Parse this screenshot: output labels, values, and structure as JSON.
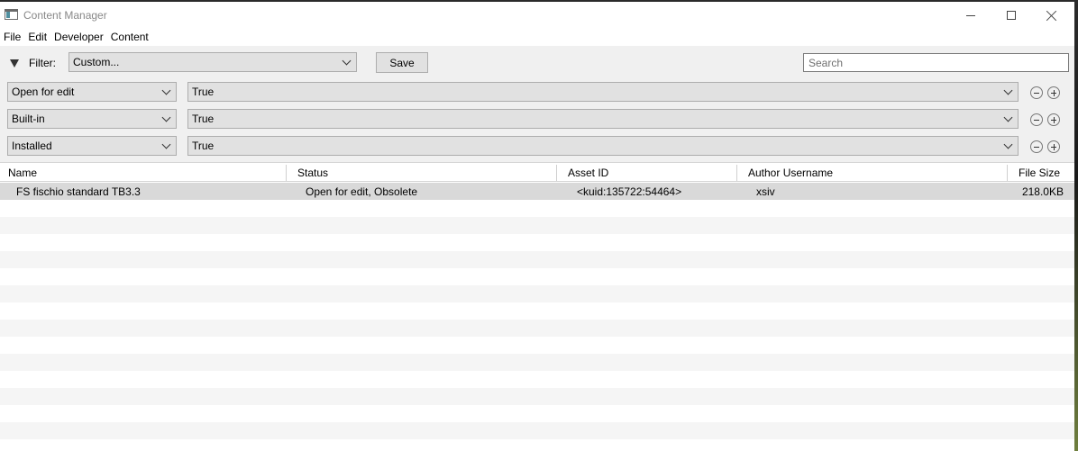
{
  "window": {
    "title": "Content Manager",
    "controls": {
      "minimize": "minimize",
      "maximize": "maximize",
      "close": "close"
    }
  },
  "menu": [
    "File",
    "Edit",
    "Developer",
    "Content"
  ],
  "filter": {
    "label": "Filter:",
    "selected": "Custom...",
    "save_label": "Save",
    "search_placeholder": "Search",
    "rules": [
      {
        "key": "Open for edit",
        "value": "True"
      },
      {
        "key": "Built-in",
        "value": "True"
      },
      {
        "key": "Installed",
        "value": "True"
      }
    ]
  },
  "table": {
    "columns": [
      "Name",
      "Status",
      "Asset ID",
      "Author Username",
      "File Size"
    ],
    "rows": [
      {
        "name": "FS fischio standard TB3.3",
        "status": "Open for edit, Obsolete",
        "asset_id": "<kuid:135722:54464>",
        "author": "xsiv",
        "size": "218.0KB"
      }
    ]
  },
  "colors": {
    "filter_bg": "#f0f0f0",
    "selected_row": "#d9d9d9",
    "alt_row": "#f5f5f5"
  }
}
